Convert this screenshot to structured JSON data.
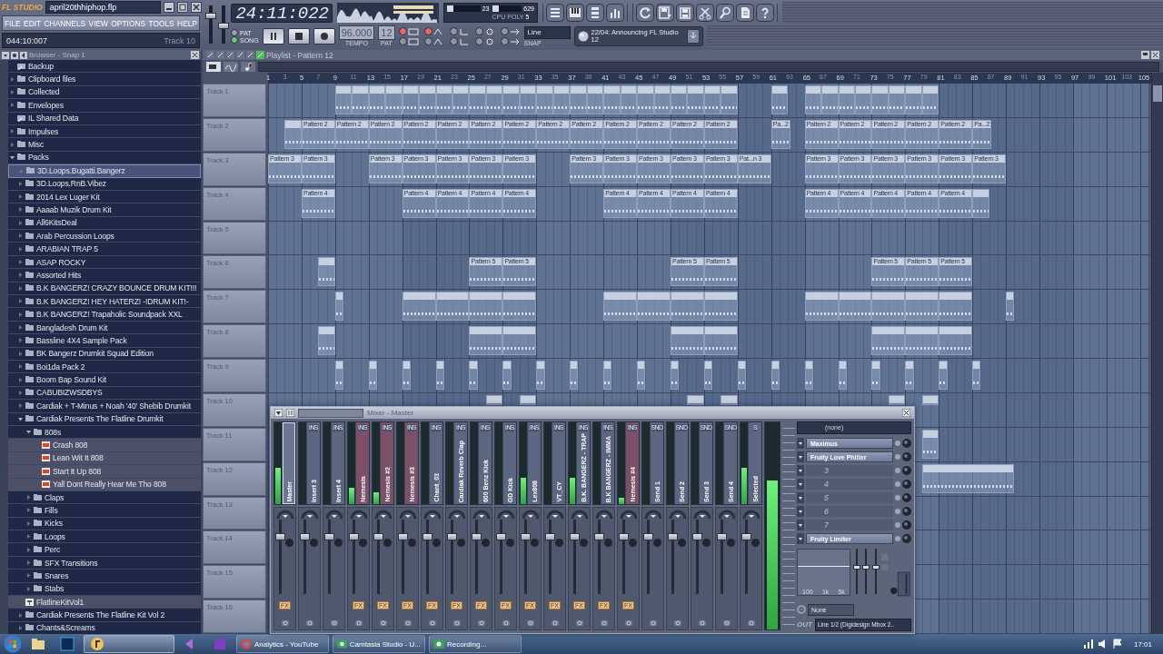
{
  "app": {
    "logo": "FL STUDIO",
    "title": "april20thhiphop.flp",
    "menu": [
      "FILE",
      "EDIT",
      "CHANNELS",
      "VIEW",
      "OPTIONS",
      "TOOLS",
      "HELP"
    ],
    "hint_position": "044:10:007",
    "hint_target": "Track 10"
  },
  "master_sliders": [
    {
      "level": 0.78
    },
    {
      "level": 0.5
    }
  ],
  "transport": {
    "time": "24:11:022",
    "modes": [
      {
        "label": "PAT",
        "selected": false
      },
      {
        "label": "SONG",
        "selected": true
      }
    ],
    "playing": true,
    "tempo": "96.000",
    "tempo_label": "TEMPO",
    "pattern": "12",
    "pattern_label": "PAT",
    "snap": "Line",
    "snap_label": "SNAP",
    "toggles": [
      {
        "on": true
      },
      {
        "on": true
      },
      {
        "on": false
      },
      {
        "on": false
      },
      {
        "on": false
      },
      {
        "on": false
      },
      {
        "on": false
      },
      {
        "on": false
      },
      {
        "on": false
      },
      {
        "on": false
      }
    ]
  },
  "monitor": {
    "cpu": {
      "value": "23",
      "level": 0.18
    },
    "memory": {
      "value": "629",
      "level": 0.22
    },
    "labels": [
      "CPU",
      "POLY"
    ],
    "poly": "5"
  },
  "news": {
    "text": "22/04: Announcing FL Studio 12"
  },
  "browser": {
    "title": "Browser - Snap 1",
    "items": [
      {
        "label": "Backup",
        "kind": "link",
        "selected": false
      },
      {
        "label": "Clipboard files",
        "kind": "folder",
        "expanded": false,
        "selected": false
      },
      {
        "label": "Collected",
        "kind": "folder",
        "expanded": false,
        "selected": false
      },
      {
        "label": "Envelopes",
        "kind": "folder",
        "expanded": false,
        "selected": false
      },
      {
        "label": "IL Shared Data",
        "kind": "link",
        "selected": false
      },
      {
        "label": "Impulses",
        "kind": "folder",
        "expanded": false,
        "selected": false
      },
      {
        "label": "Misc",
        "kind": "folder",
        "expanded": false,
        "selected": false
      },
      {
        "label": "Packs",
        "kind": "folder",
        "expanded": true,
        "selected": false,
        "children": [
          {
            "label": "3D.Loops.Bugatti.Bangerz",
            "kind": "folder",
            "expanded": false,
            "selected": true
          },
          {
            "label": "3D.Loops.RnB.Vibez",
            "kind": "folder",
            "expanded": false,
            "selected": false
          },
          {
            "label": "2014 Lex Luger Kit",
            "kind": "folder",
            "expanded": false,
            "selected": false
          },
          {
            "label": "Aaaab Muzik Drum Kit",
            "kind": "folder",
            "expanded": false,
            "selected": false
          },
          {
            "label": "All6KitsDeal",
            "kind": "folder",
            "expanded": false,
            "selected": false
          },
          {
            "label": "Arab Percussion Loops",
            "kind": "folder",
            "expanded": false,
            "selected": false
          },
          {
            "label": "ARABIAN TRAP 5",
            "kind": "folder",
            "expanded": false,
            "selected": false
          },
          {
            "label": "ASAP ROCKY",
            "kind": "folder",
            "expanded": false,
            "selected": false
          },
          {
            "label": "Assorted Hits",
            "kind": "folder",
            "expanded": false,
            "selected": false
          },
          {
            "label": "B.K BANGERZ! CRAZY BOUNCE DRUM KIT!!!",
            "kind": "folder",
            "expanded": false,
            "selected": false
          },
          {
            "label": "B.K BANGERZ! HEY HATERZ! -!DRUM KIT!-",
            "kind": "folder",
            "expanded": false,
            "selected": false
          },
          {
            "label": "B.K BANGERZ! Trapaholic Soundpack XXL",
            "kind": "folder",
            "expanded": false,
            "selected": false
          },
          {
            "label": "Bangladesh Drum Kit",
            "kind": "folder",
            "expanded": false,
            "selected": false
          },
          {
            "label": "Bassline 4X4 Sample Pack",
            "kind": "folder",
            "expanded": false,
            "selected": false
          },
          {
            "label": "BK Bangerz Drumkit Squad Edition",
            "kind": "folder",
            "expanded": false,
            "selected": false
          },
          {
            "label": "Boi1da Pack 2",
            "kind": "folder",
            "expanded": false,
            "selected": false
          },
          {
            "label": "Boom Bap Sound Kit",
            "kind": "folder",
            "expanded": false,
            "selected": false
          },
          {
            "label": "CABUBIZWSDBYS",
            "kind": "folder",
            "expanded": false,
            "selected": false
          },
          {
            "label": "Cardiak + T-Minus + Noah '40' Shebib Drumkit",
            "kind": "folder",
            "expanded": false,
            "selected": false
          },
          {
            "label": "Cardiak Presents The Flatline Drumkit",
            "kind": "folder",
            "expanded": true,
            "selected": false,
            "children": [
              {
                "label": "808s",
                "kind": "folder",
                "expanded": true,
                "selected": false,
                "children": [
                  {
                    "label": "Crash 808",
                    "kind": "file",
                    "selected": false
                  },
                  {
                    "label": "Lean Wit It 808",
                    "kind": "file",
                    "selected": false
                  },
                  {
                    "label": "Start It Up 808",
                    "kind": "file",
                    "selected": false
                  },
                  {
                    "label": "Yall Dont Really Hear Me Tho 808",
                    "kind": "file",
                    "selected": false
                  }
                ]
              },
              {
                "label": "Claps",
                "kind": "folder",
                "expanded": false,
                "selected": false
              },
              {
                "label": "Fills",
                "kind": "folder",
                "expanded": false,
                "selected": false
              },
              {
                "label": "Kicks",
                "kind": "folder",
                "expanded": false,
                "selected": false
              },
              {
                "label": "Loops",
                "kind": "folder",
                "expanded": false,
                "selected": false
              },
              {
                "label": "Perc",
                "kind": "folder",
                "expanded": false,
                "selected": false
              },
              {
                "label": "SFX Transitions",
                "kind": "folder",
                "expanded": false,
                "selected": false
              },
              {
                "label": "Snares",
                "kind": "folder",
                "expanded": false,
                "selected": false
              },
              {
                "label": "Stabs",
                "kind": "folder",
                "expanded": false,
                "selected": false
              }
            ]
          },
          {
            "label": "FlatlineKitVol1",
            "kind": "project",
            "selected": false
          },
          {
            "label": "Cardiak Presents The Flatline Kit Vol 2",
            "kind": "folder",
            "expanded": false,
            "selected": false
          },
          {
            "label": "Chants&Screams",
            "kind": "folder",
            "expanded": false,
            "selected": false
          }
        ]
      }
    ]
  },
  "playlist": {
    "title": "Playlist - Pattern 12",
    "ruler": [
      "1",
      "3",
      "5",
      "7",
      "9",
      "11",
      "13",
      "15",
      "17",
      "19",
      "21",
      "23",
      "25",
      "27",
      "29",
      "31",
      "33",
      "35",
      "37",
      "39",
      "41",
      "43",
      "45",
      "47",
      "49",
      "51",
      "53",
      "55",
      "57",
      "59",
      "61",
      "63",
      "65",
      "67",
      "69",
      "71",
      "73",
      "75",
      "77",
      "79",
      "81",
      "83",
      "85",
      "87",
      "89",
      "91",
      "93",
      "95",
      "97",
      "99",
      "101",
      "103",
      "105"
    ],
    "tracks": [
      {
        "label": "Track 1"
      },
      {
        "label": "Track 2",
        "clips": [
          {
            "label": "Pattern 2"
          },
          {
            "label": "Pattern 2"
          },
          {
            "label": "Pattern 2"
          },
          {
            "label": "Pattern 2"
          },
          {
            "label": "Pattern 2"
          },
          {
            "label": "Pattern 2"
          },
          {
            "label": "Pattern 2"
          },
          {
            "label": "Pattern 2"
          },
          {
            "label": "Pattern 2"
          },
          {
            "label": "Pattern 2"
          },
          {
            "label": "Pattern 2"
          },
          {
            "label": "Pattern 2"
          },
          {
            "label": "Pattern 2"
          },
          {
            "label": "Pa...2"
          },
          {
            "label": "Pattern 2"
          },
          {
            "label": "Pattern 2"
          },
          {
            "label": "Pattern 2"
          },
          {
            "label": "Pattern 2"
          },
          {
            "label": "Pattern 2"
          },
          {
            "label": "Pa...2"
          }
        ]
      },
      {
        "label": "Track 3",
        "clips": [
          {
            "label": "Pattern 3"
          },
          {
            "label": "Pattern 3"
          },
          {
            "label": "Pattern 3"
          },
          {
            "label": "Pattern 3"
          },
          {
            "label": "Pattern 3"
          },
          {
            "label": "Pattern 3"
          },
          {
            "label": "Pattern 3"
          },
          {
            "label": "Pattern 3"
          },
          {
            "label": "Pattern 3"
          },
          {
            "label": "Pattern 3"
          },
          {
            "label": "Pattern 3"
          },
          {
            "label": "Pattern 3"
          },
          {
            "label": "Pat...n 3"
          },
          {
            "label": "Pattern 3"
          },
          {
            "label": "Pattern 3"
          },
          {
            "label": "Pattern 3"
          },
          {
            "label": "Pattern 3"
          },
          {
            "label": "Pattern 3"
          },
          {
            "label": "Pattern 3"
          }
        ]
      },
      {
        "label": "Track 4",
        "clips": [
          {
            "label": "Pattern 4"
          },
          {
            "label": "Pattern 4"
          },
          {
            "label": "Pattern 4"
          },
          {
            "label": "Pattern 4"
          },
          {
            "label": "Pattern 4"
          },
          {
            "label": "Pattern 4"
          },
          {
            "label": "Pattern 4"
          },
          {
            "label": "Pattern 4"
          },
          {
            "label": "Pattern 4"
          },
          {
            "label": "Pattern 4"
          },
          {
            "label": "Pattern 4"
          },
          {
            "label": "Pattern 4"
          },
          {
            "label": "Pattern 4"
          },
          {
            "label": "Pattern 4"
          }
        ]
      },
      {
        "label": "Track 5"
      },
      {
        "label": "Track 6",
        "clips": [
          {
            "label": "Pattern 5"
          },
          {
            "label": "Pattern 5"
          },
          {
            "label": "Pattern 5"
          },
          {
            "label": "Pattern 5"
          },
          {
            "label": "Pattern 5"
          },
          {
            "label": "Pattern 5"
          },
          {
            "label": "Pattern 5"
          }
        ]
      },
      {
        "label": "Track 7"
      },
      {
        "label": "Track 8"
      },
      {
        "label": "Track 9"
      },
      {
        "label": "Track 10"
      },
      {
        "label": "Track 11"
      },
      {
        "label": "Track 12"
      },
      {
        "label": "Track 13"
      },
      {
        "label": "Track 14"
      },
      {
        "label": "Track 15"
      },
      {
        "label": "Track 16"
      }
    ]
  },
  "mixer": {
    "title": "Mixer - Master",
    "strips": [
      {
        "name": "Master",
        "color": "#6b7791",
        "selected": true,
        "level": 0.45,
        "fader": {
          "level": 0.8
        },
        "fx": "FX"
      },
      {
        "name": "Insert 3",
        "tag": "INS",
        "color": "#5b6680",
        "selected": false,
        "level": 0,
        "fader": {
          "level": 0.8
        }
      },
      {
        "name": "Insert 4",
        "tag": "INS",
        "color": "#5b6680",
        "selected": false,
        "level": 0,
        "fader": {
          "level": 0.8
        }
      },
      {
        "name": "Nemesis",
        "tag": "INS",
        "color": "#7c5068",
        "selected": false,
        "level": 0.2,
        "fader": {
          "level": 0.8
        },
        "fx": "FX"
      },
      {
        "name": "Nemesis #2",
        "tag": "INS",
        "color": "#7c5068",
        "selected": false,
        "level": 0.15,
        "fader": {
          "level": 0.8
        },
        "fx": "FX"
      },
      {
        "name": "Nemesis #3",
        "tag": "INS",
        "color": "#7c5068",
        "selected": false,
        "level": 0,
        "fader": {
          "level": 0.8
        },
        "fx": "FX"
      },
      {
        "name": "Chant_03",
        "tag": "INS",
        "color": "#5b6680",
        "selected": false,
        "level": 0,
        "fader": {
          "level": 0.8
        },
        "fx": "FX"
      },
      {
        "name": "Cardiak Reverb Clap",
        "tag": "INS",
        "color": "#5b6680",
        "selected": false,
        "level": 0,
        "fader": {
          "level": 0.8
        },
        "fx": "FX"
      },
      {
        "name": "600 Benz Kick",
        "tag": "INS",
        "color": "#5b6680",
        "selected": false,
        "level": 0,
        "fader": {
          "level": 0.8
        },
        "fx": "FX"
      },
      {
        "name": "GD Kick",
        "tag": "INS",
        "color": "#5b6680",
        "selected": false,
        "level": 0,
        "fader": {
          "level": 0.8
        },
        "fx": "FX"
      },
      {
        "name": "Lex808",
        "tag": "INS",
        "color": "#5b6680",
        "selected": false,
        "level": 0.32,
        "fader": {
          "level": 0.8
        },
        "fx": "FX"
      },
      {
        "name": "VT_CY",
        "tag": "INS",
        "color": "#5b6680",
        "selected": false,
        "level": 0,
        "fader": {
          "level": 0.8
        },
        "fx": "FX"
      },
      {
        "name": "B.K. BANGERZ - TRAP",
        "tag": "INS",
        "color": "#5b6680",
        "selected": false,
        "level": 0.32,
        "fader": {
          "level": 0.8
        },
        "fx": "FX"
      },
      {
        "name": "B.K BANGERZ - IMMA",
        "tag": "INS",
        "color": "#5b6680",
        "selected": false,
        "level": 0,
        "fader": {
          "level": 0.8
        },
        "fx": "FX"
      },
      {
        "name": "Nemesis #4",
        "tag": "INS",
        "color": "#7c5068",
        "selected": false,
        "level": 0.08,
        "fader": {
          "level": 0.8
        },
        "fx": "FX"
      },
      {
        "name": "Send 1",
        "tag": "SND",
        "color": "#5b6680",
        "selected": false,
        "level": 0,
        "fader": {
          "level": 0.8
        }
      },
      {
        "name": "Send 2",
        "tag": "SND",
        "color": "#5b6680",
        "selected": false,
        "level": 0,
        "fader": {
          "level": 0.8
        }
      },
      {
        "name": "Send 3",
        "tag": "SND",
        "color": "#5b6680",
        "selected": false,
        "level": 0,
        "fader": {
          "level": 0.8
        }
      },
      {
        "name": "Send 4",
        "tag": "SND",
        "color": "#5b6680",
        "selected": false,
        "level": 0,
        "fader": {
          "level": 0.8
        }
      },
      {
        "name": "Selected",
        "tag": "S",
        "color": "#5b6680",
        "selected": false,
        "level": 0.45,
        "fader": {
          "level": 0.8
        }
      }
    ],
    "master_meter": {
      "level": 0.72
    },
    "input": "(none)",
    "slots": [
      {
        "kind": "plugin",
        "label": "Maximus"
      },
      {
        "kind": "plugin",
        "label": "Fruity Love Philter"
      },
      {
        "kind": "empty",
        "label": "3"
      },
      {
        "kind": "empty",
        "label": "4"
      },
      {
        "kind": "empty",
        "label": "5"
      },
      {
        "kind": "empty",
        "label": "6"
      },
      {
        "kind": "empty",
        "label": "7"
      },
      {
        "kind": "plugin",
        "label": "Fruity Limiter"
      }
    ],
    "eq_labels": [
      "100",
      "1k",
      "5k"
    ],
    "eq_sliders": [
      {
        "level": 0.6
      },
      {
        "level": 0.6
      },
      {
        "level": 0.6
      }
    ],
    "preset": "None",
    "out_label": "OUT",
    "output": "Line 1/2 (Digidesign Mbox 2.."
  },
  "taskbar": {
    "pinned": [
      {
        "kind": "folder",
        "selected": false
      },
      {
        "kind": "photo",
        "selected": false
      },
      {
        "kind": "daw",
        "selected": true
      },
      {
        "kind": "arrow",
        "selected": false
      },
      {
        "kind": "square",
        "selected": false
      }
    ],
    "tasks": [
      {
        "label": "Analytics - YouTube",
        "kind": "browser"
      },
      {
        "label": "Camtasia Studio - U...",
        "kind": "recorder"
      },
      {
        "label": "Recording...",
        "kind": "recorder"
      }
    ],
    "clock": "17:01"
  }
}
